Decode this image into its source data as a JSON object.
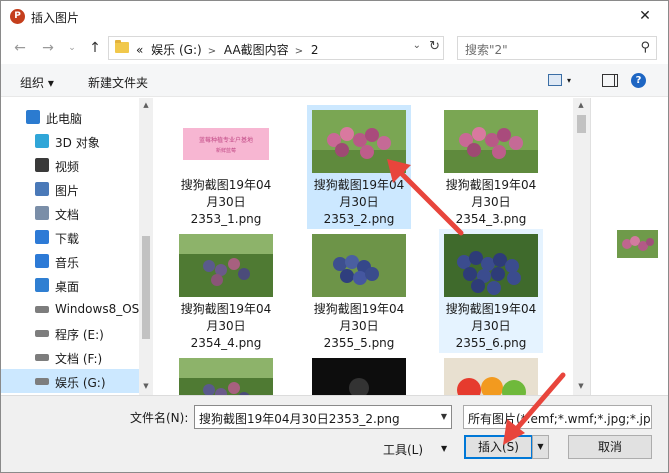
{
  "window": {
    "title": "插入图片",
    "app_icon": "P"
  },
  "nav": {
    "breadcrumb": [
      "«",
      "娱乐 (G:)",
      "AA截图内容",
      "2"
    ],
    "search_placeholder": "搜索\"2\""
  },
  "toolbar": {
    "organize_label": "组织 ▾",
    "new_folder_label": "新建文件夹"
  },
  "sidebar": {
    "items": [
      {
        "label": "此电脑",
        "icon": "computer-icon"
      },
      {
        "label": "3D 对象",
        "icon": "cube-3d-icon"
      },
      {
        "label": "视频",
        "icon": "video-icon"
      },
      {
        "label": "图片",
        "icon": "picture-icon"
      },
      {
        "label": "文档",
        "icon": "document-icon"
      },
      {
        "label": "下载",
        "icon": "download-icon"
      },
      {
        "label": "音乐",
        "icon": "music-icon"
      },
      {
        "label": "桌面",
        "icon": "desktop-icon"
      },
      {
        "label": "Windows8_OS",
        "icon": "drive-icon"
      },
      {
        "label": "程序 (E:)",
        "icon": "drive-icon"
      },
      {
        "label": "文档 (F:)",
        "icon": "drive-icon"
      },
      {
        "label": "娱乐 (G:)",
        "icon": "drive-icon",
        "selected": true
      }
    ]
  },
  "files": [
    {
      "line1": "搜狗截图19年04",
      "line2": "月30日",
      "line3": "2353_1.png",
      "kind": "banner"
    },
    {
      "line1": "搜狗截图19年04",
      "line2": "月30日",
      "line3": "2353_2.png",
      "kind": "pinkberry",
      "selected": true
    },
    {
      "line1": "搜狗截图19年04",
      "line2": "月30日",
      "line3": "2354_3.png",
      "kind": "pinkberry"
    },
    {
      "line1": "搜狗截图19年04",
      "line2": "月30日",
      "line3": "2354_4.png",
      "kind": "bushberry"
    },
    {
      "line1": "搜狗截图19年04",
      "line2": "月30日",
      "line3": "2355_5.png",
      "kind": "blueberry"
    },
    {
      "line1": "搜狗截图19年04",
      "line2": "月30日",
      "line3": "2355_6.png",
      "kind": "blueberry2",
      "hover": true
    },
    {
      "line1": "",
      "line2": "",
      "line3": "",
      "kind": "bushberry"
    },
    {
      "line1": "",
      "line2": "",
      "line3": "",
      "kind": "dark"
    },
    {
      "line1": "",
      "line2": "",
      "line3": "",
      "kind": "fruit"
    }
  ],
  "banner_text": {
    "line1": "蓝莓种植专业户基地",
    "line2": "新鲜蓝莓"
  },
  "bottom": {
    "filename_label": "文件名(N):",
    "filename_value": "搜狗截图19年04月30日2353_2.png",
    "filetype_value": "所有图片(*.emf;*.wmf;*.jpg;*.jpeg",
    "tools_label": "工具(L)",
    "insert_label": "插入(S)",
    "cancel_label": "取消"
  },
  "colors": {
    "selection": "#cce8ff",
    "accent": "#0078d7",
    "arrow": "#e8453c"
  }
}
